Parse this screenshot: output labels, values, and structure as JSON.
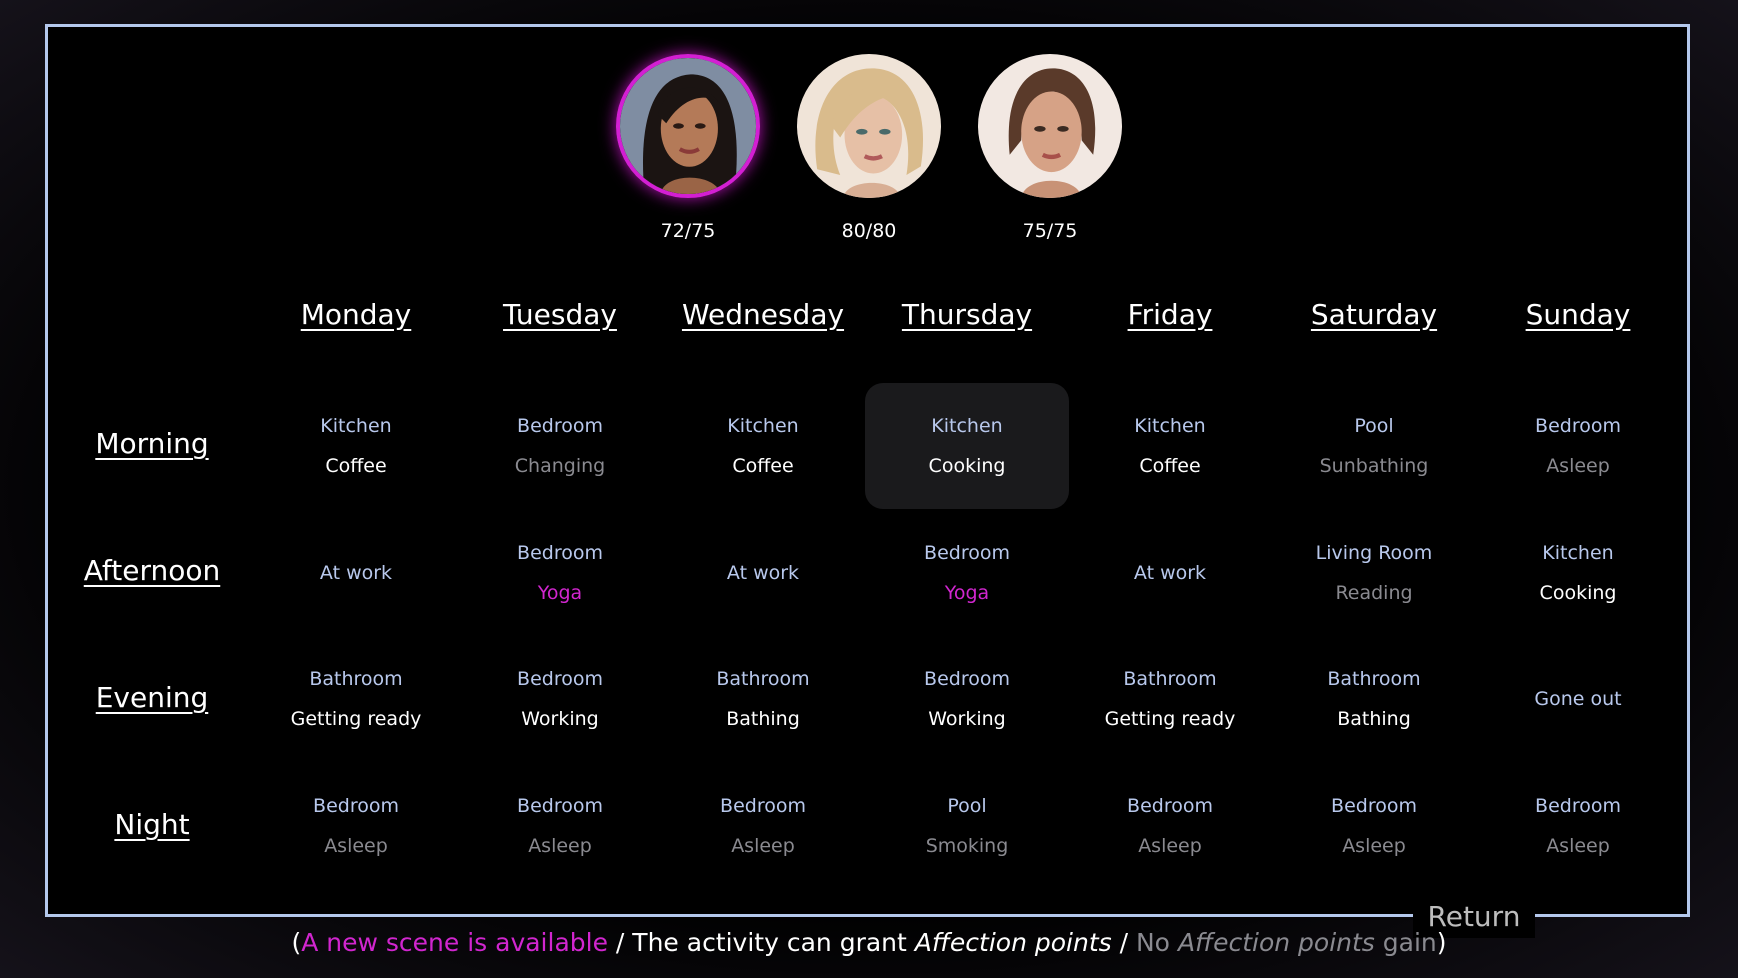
{
  "colors": {
    "frame_border": "#b4c8ec",
    "location_text": "#b8c8ec",
    "activity_available": "#ffffff",
    "activity_no_gain": "#8a8a90",
    "new_scene": "#d126cf",
    "selected_ring": "#d31fd3"
  },
  "characters": [
    {
      "score": "72/75",
      "selected": true,
      "icon": "character-portrait-dark-hair"
    },
    {
      "score": "80/80",
      "selected": false,
      "icon": "character-portrait-blonde"
    },
    {
      "score": "75/75",
      "selected": false,
      "icon": "character-portrait-brunette"
    }
  ],
  "days": [
    "Monday",
    "Tuesday",
    "Wednesday",
    "Thursday",
    "Friday",
    "Saturday",
    "Sunday"
  ],
  "periods": [
    "Morning",
    "Afternoon",
    "Evening",
    "Night"
  ],
  "schedule": [
    [
      {
        "location": "Kitchen",
        "activity": "Coffee",
        "type": "available"
      },
      {
        "location": "Bedroom",
        "activity": "Changing",
        "type": "none"
      },
      {
        "location": "Kitchen",
        "activity": "Coffee",
        "type": "available"
      },
      {
        "location": "Kitchen",
        "activity": "Cooking",
        "type": "available",
        "current": true
      },
      {
        "location": "Kitchen",
        "activity": "Coffee",
        "type": "available"
      },
      {
        "location": "Pool",
        "activity": "Sunbathing",
        "type": "none"
      },
      {
        "location": "Bedroom",
        "activity": "Asleep",
        "type": "none"
      }
    ],
    [
      {
        "location": "At work",
        "activity": "",
        "type": "available"
      },
      {
        "location": "Bedroom",
        "activity": "Yoga",
        "type": "scene"
      },
      {
        "location": "At work",
        "activity": "",
        "type": "available"
      },
      {
        "location": "Bedroom",
        "activity": "Yoga",
        "type": "scene"
      },
      {
        "location": "At work",
        "activity": "",
        "type": "available"
      },
      {
        "location": "Living Room",
        "activity": "Reading",
        "type": "none"
      },
      {
        "location": "Kitchen",
        "activity": "Cooking",
        "type": "available"
      }
    ],
    [
      {
        "location": "Bathroom",
        "activity": "Getting ready",
        "type": "available"
      },
      {
        "location": "Bedroom",
        "activity": "Working",
        "type": "available"
      },
      {
        "location": "Bathroom",
        "activity": "Bathing",
        "type": "available"
      },
      {
        "location": "Bedroom",
        "activity": "Working",
        "type": "available"
      },
      {
        "location": "Bathroom",
        "activity": "Getting ready",
        "type": "available"
      },
      {
        "location": "Bathroom",
        "activity": "Bathing",
        "type": "available"
      },
      {
        "location": "Gone out",
        "activity": "",
        "type": "available"
      }
    ],
    [
      {
        "location": "Bedroom",
        "activity": "Asleep",
        "type": "none"
      },
      {
        "location": "Bedroom",
        "activity": "Asleep",
        "type": "none"
      },
      {
        "location": "Bedroom",
        "activity": "Asleep",
        "type": "none"
      },
      {
        "location": "Pool",
        "activity": "Smoking",
        "type": "none"
      },
      {
        "location": "Bedroom",
        "activity": "Asleep",
        "type": "none"
      },
      {
        "location": "Bedroom",
        "activity": "Asleep",
        "type": "none"
      },
      {
        "location": "Bedroom",
        "activity": "Asleep",
        "type": "none"
      }
    ]
  ],
  "return_label": "Return",
  "legend": {
    "open": "(",
    "scene": "A new scene is available",
    "sep1": " / The activity can grant ",
    "affection1": "Affection points",
    "sep2": " / ",
    "no": "No ",
    "affection2": "Affection points",
    "gain": " gain",
    "close": ")"
  }
}
